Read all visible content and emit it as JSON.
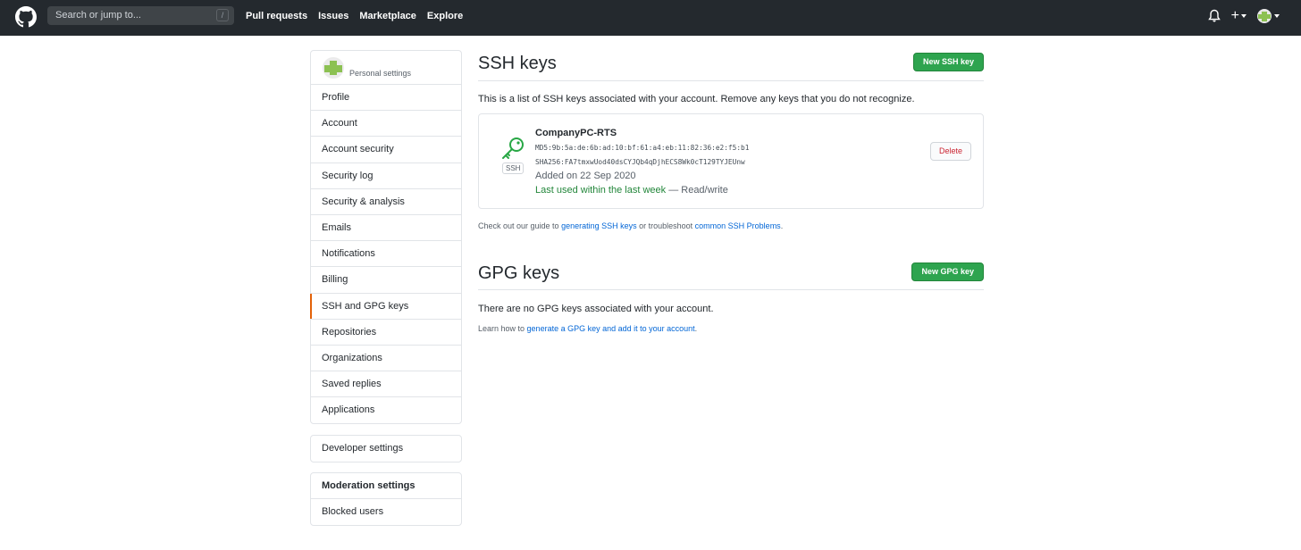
{
  "header": {
    "search_placeholder": "Search or jump to...",
    "search_shortcut": "/",
    "nav": [
      "Pull requests",
      "Issues",
      "Marketplace",
      "Explore"
    ],
    "plus_label": "+"
  },
  "sidebar": {
    "header_label": "Personal settings",
    "items": [
      {
        "label": "Profile",
        "selected": false
      },
      {
        "label": "Account",
        "selected": false
      },
      {
        "label": "Account security",
        "selected": false
      },
      {
        "label": "Security log",
        "selected": false
      },
      {
        "label": "Security & analysis",
        "selected": false
      },
      {
        "label": "Emails",
        "selected": false
      },
      {
        "label": "Notifications",
        "selected": false
      },
      {
        "label": "Billing",
        "selected": false
      },
      {
        "label": "SSH and GPG keys",
        "selected": true
      },
      {
        "label": "Repositories",
        "selected": false
      },
      {
        "label": "Organizations",
        "selected": false
      },
      {
        "label": "Saved replies",
        "selected": false
      },
      {
        "label": "Applications",
        "selected": false
      }
    ],
    "developer_settings": "Developer settings",
    "moderation": {
      "heading": "Moderation settings",
      "items": [
        "Blocked users"
      ]
    }
  },
  "ssh": {
    "title": "SSH keys",
    "new_button": "New SSH key",
    "description": "This is a list of SSH keys associated with your account. Remove any keys that you do not recognize.",
    "keys": [
      {
        "badge": "SSH",
        "title": "CompanyPC-RTS",
        "md5": "MD5:9b:5a:de:6b:ad:10:bf:61:a4:eb:11:82:36:e2:f5:b1",
        "sha256": "SHA256:FA7tmxwUod40dsCYJQb4qDjhECS8Wk0cT129TYJEUnw",
        "added": "Added on 22 Sep 2020",
        "last_used": "Last used within the last week",
        "access": " — Read/write",
        "delete_label": "Delete"
      }
    ],
    "guide": {
      "prefix": "Check out our guide to ",
      "link1": "generating SSH keys",
      "middle": " or troubleshoot ",
      "link2": "common SSH Problems",
      "suffix": "."
    }
  },
  "gpg": {
    "title": "GPG keys",
    "new_button": "New GPG key",
    "empty": "There are no GPG keys associated with your account.",
    "learn": {
      "prefix": "Learn how to ",
      "link": "generate a GPG key and add it to your account",
      "suffix": "."
    }
  },
  "colors": {
    "header_bg": "#24292e",
    "primary_green": "#2ea44f",
    "selected_accent": "#e36209",
    "link": "#0366d6",
    "danger": "#cb2431",
    "avatar_green": "#8cc152"
  }
}
